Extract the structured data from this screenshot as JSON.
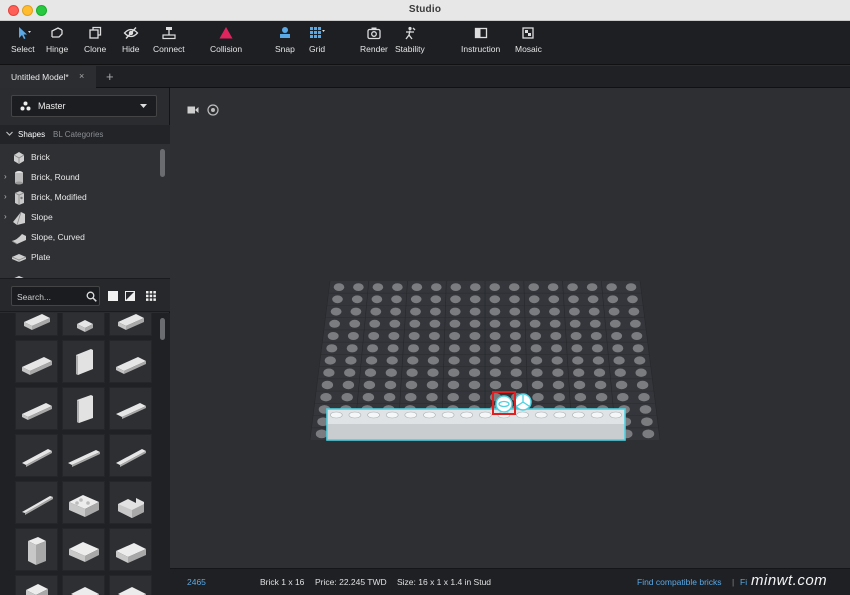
{
  "window": {
    "title": "Studio"
  },
  "toolbar": {
    "items": [
      {
        "label": "Select",
        "icon": "cursor-icon"
      },
      {
        "label": "Hinge",
        "icon": "hinge-icon"
      },
      {
        "label": "Clone",
        "icon": "clone-icon"
      },
      {
        "label": "Hide",
        "icon": "eye-slash-icon"
      },
      {
        "label": "Connect",
        "icon": "connect-icon"
      },
      {
        "label": "Collision",
        "icon": "collision-triangle-icon"
      },
      {
        "label": "Snap",
        "icon": "snap-icon"
      },
      {
        "label": "Grid",
        "icon": "grid-icon"
      },
      {
        "label": "Render",
        "icon": "camera-icon"
      },
      {
        "label": "Stability",
        "icon": "stability-icon"
      },
      {
        "label": "Instruction",
        "icon": "instruction-icon"
      },
      {
        "label": "Mosaic",
        "icon": "mosaic-icon"
      }
    ],
    "accent_color": "#5aa9e6",
    "collision_color": "#e0245e"
  },
  "tabs": {
    "model_tab": "Untitled Model*",
    "close_glyph": "×",
    "add_glyph": "+"
  },
  "sidebar": {
    "palette": "Master",
    "category_tabs": [
      "Shapes",
      "BL Categories"
    ],
    "categories": [
      {
        "label": "Brick",
        "expandable": false
      },
      {
        "label": "Brick, Round",
        "expandable": true
      },
      {
        "label": "Brick, Modified",
        "expandable": true
      },
      {
        "label": "Slope",
        "expandable": true
      },
      {
        "label": "Slope, Curved",
        "expandable": false
      },
      {
        "label": "Plate",
        "expandable": false
      }
    ],
    "search": {
      "placeholder": "Search..."
    }
  },
  "status": {
    "part_number": "2465",
    "part_name": "Brick 1 x 16",
    "price": "Price: 22.245 TWD",
    "size": "Size: 16 x 1 x 1.4 in Stud",
    "link": "Find compatible bricks",
    "separator": "|",
    "watermark": "minwt.com"
  },
  "colors": {
    "highlight": "#4fd1e0",
    "selection_box": "#e02020"
  }
}
